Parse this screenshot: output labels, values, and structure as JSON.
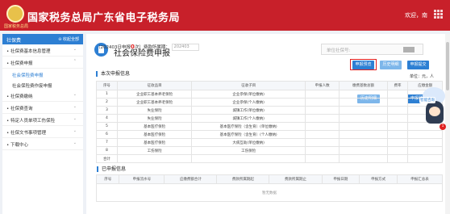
{
  "header": {
    "brand": "国家税务总局广东省电子税务局",
    "logo_sub": "国家税务总局",
    "welcome": "欢迎，",
    "user_name": "南"
  },
  "sidebar": {
    "title": "社保费",
    "fold_label": "收起全部",
    "items": [
      {
        "label": "社保费基本信息管理",
        "sub": false
      },
      {
        "label": "社保费申报",
        "sub": false
      },
      {
        "label": "社会保险费申报",
        "sub": true
      },
      {
        "label": "社会保险费作废申报",
        "sub": true
      },
      {
        "label": "社保费缴纳",
        "sub": false
      },
      {
        "label": "社保费查询",
        "sub": false
      },
      {
        "label": "特定人员单项工伤保险",
        "sub": false
      },
      {
        "label": "社保文书事项管理",
        "sub": false
      },
      {
        "label": "下载中心",
        "sub": false
      }
    ]
  },
  "main": {
    "title": "社会保险费申报",
    "unit_placeholder": "单位社保号:",
    "section1_title": "本次申报信息",
    "period_prefix": "（202403日申报",
    "period_count": "0",
    "period_mid": "次）费款所属期：",
    "period_value": "202403",
    "buttons": {
      "declare": "申报预览",
      "history": "历史明细",
      "complete": "申报提交"
    },
    "unit_note": "单位：元，人",
    "table1": {
      "headers": [
        "序号",
        "征收品目",
        "征收子目",
        "申报人数",
        "缴费基数总额",
        "费率",
        "应缴金额"
      ],
      "rows": [
        [
          "1",
          "企业职工基本养老保险",
          "企业参保(单位缴纳)",
          "",
          "",
          "",
          ""
        ],
        [
          "2",
          "企业职工基本养老保险",
          "企业参保(个人缴纳)",
          "",
          "",
          "",
          ""
        ],
        [
          "3",
          "失业保险",
          "城镇工作(单位缴纳)",
          "",
          "",
          "",
          ""
        ],
        [
          "4",
          "失业保险",
          "城镇工作(个人缴纳)",
          "",
          "",
          "",
          ""
        ],
        [
          "5",
          "基本医疗保险",
          "基本医疗保险（含生育）(单位缴纳)",
          "",
          "",
          "",
          ""
        ],
        [
          "6",
          "基本医疗保险",
          "基本医疗保险（含生育）(个人缴纳)",
          "",
          "",
          "",
          ""
        ],
        [
          "7",
          "基本医疗保险",
          "大病互助(单位缴纳)",
          "",
          "",
          "",
          ""
        ],
        [
          "8",
          "工伤保险",
          "工伤保险",
          "",
          "",
          "",
          ""
        ]
      ],
      "total_label": "合计"
    },
    "section2_title": "已申报信息",
    "table2": {
      "headers": [
        "序号",
        "申报流水号",
        "应缴费额合计",
        "费款所属期起",
        "费款所属期止",
        "申报日期",
        "申报方式",
        "申报汇总表"
      ],
      "empty_text": "暂无数据"
    }
  },
  "assistant": {
    "label": "智能咨询",
    "badge": "1"
  },
  "colors": {
    "header_bg": "#c8202a",
    "accent": "#2d7fd3",
    "highlight_red": "#e02020"
  }
}
